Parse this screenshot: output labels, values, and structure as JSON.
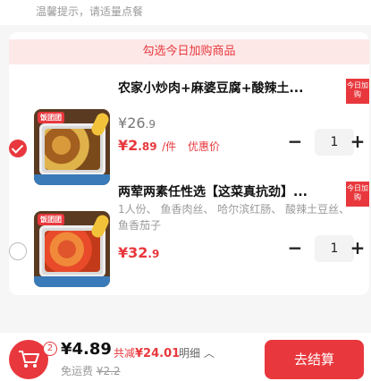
{
  "tip": "温馨提示，请适量点餐",
  "banner": "勾选今日加购商品",
  "items": [
    {
      "title": "农家小炒肉+麻婆豆腐+酸辣土...",
      "ribbon": "今日加购",
      "orig_int": "26",
      "orig_dec": ".9",
      "price_int": "2",
      "price_dec": ".89",
      "unit": "/件",
      "tag": "优惠价",
      "qty": "1",
      "selected": true,
      "thumb_logo": "饭团团"
    },
    {
      "title": "两荤两素任性选【这菜真抗劲】...",
      "ribbon": "今日加购",
      "desc": "1人份、 鱼香肉丝、 哈尔滨红肠、 酸辣土豆丝、 鱼香茄子",
      "price_int": "32",
      "price_dec": ".9",
      "qty": "1",
      "selected": false,
      "thumb_logo": "饭团团"
    }
  ],
  "footer": {
    "cart_count": "2",
    "total": "¥4.89",
    "saved_label": "共减",
    "saved_amount": "¥24.01",
    "detail": "明细",
    "ship_label": "免运费",
    "ship_orig": "¥2.2",
    "checkout": "去结算"
  },
  "colors": {
    "accent": "#e8383d"
  }
}
